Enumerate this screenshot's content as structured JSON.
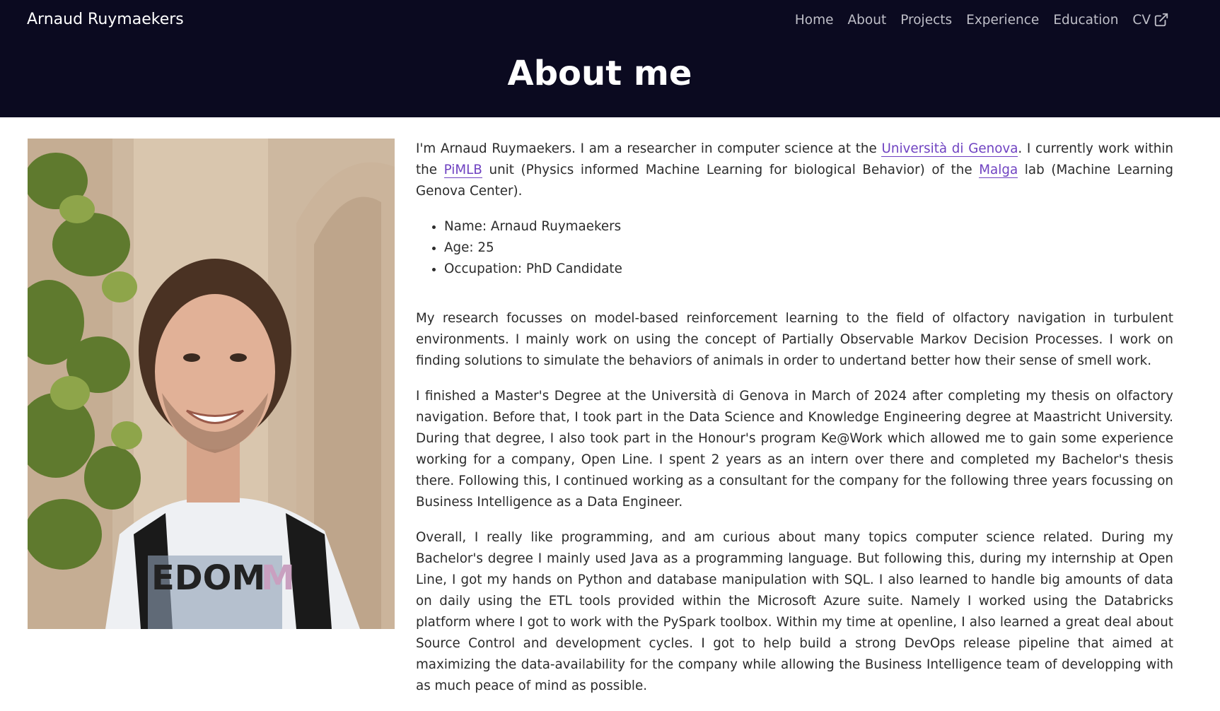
{
  "header": {
    "brand": "Arnaud Ruymaekers",
    "nav": [
      "Home",
      "About",
      "Projects",
      "Experience",
      "Education",
      "CV"
    ],
    "cv_icon": "external-link-icon",
    "title": "About me"
  },
  "portrait": {
    "shirt_text": "EDOM",
    "shirt_text_tail": "M"
  },
  "intro": {
    "t1": "I'm Arnaud Ruymaekers. I am a researcher in computer science at the ",
    "link_unige": "Università di Genova",
    "t2": ". I currently work within the ",
    "link_pimlb": "PiMLB",
    "t3": " unit (Physics informed Machine Learning for biological Behavior) of the ",
    "link_malga": "Malga",
    "t4": " lab (Machine Learning Genova Center)."
  },
  "facts": [
    "Name: Arnaud Ruymaekers",
    "Age: 25",
    "Occupation: PhD Candidate"
  ],
  "paragraphs": [
    "My research focusses on model-based reinforcement learning to the field of olfactory navigation in turbulent environments. I mainly work on using the concept of Partially Observable Markov Decision Processes. I work on finding solutions to simulate the behaviors of animals in order to undertand better how their sense of smell work.",
    "I finished a Master's Degree at the Università di Genova in March of 2024 after completing my thesis on olfactory navigation. Before that, I took part in the Data Science and Knowledge Engineering degree at Maastricht University. During that degree, I also took part in the Honour's program Ke@Work which allowed me to gain some experience working for a company, Open Line. I spent 2 years as an intern over there and completed my Bachelor's thesis there. Following this, I continued working as a consultant for the company for the following three years focussing on Business Intelligence as a Data Engineer.",
    "Overall, I really like programming, and am curious about many topics computer science related. During my Bachelor's degree I mainly used Java as a programming language. But following this, during my internship at Open Line, I got my hands on Python and database manipulation with SQL. I also learned to handle big amounts of data on daily using the ETL tools provided within the Microsoft Azure suite. Namely I worked using the Databricks platform where I got to work with the PySpark toolbox. Within my time at openline, I also learned a great deal about Source Control and development cycles. I got to help build a strong DevOps release pipeline that aimed at maximizing the data-availability for the company while allowing the Business Intelligence team of developping with as much peace of mind as possible."
  ],
  "colors": {
    "header_bg": "#0b0a20",
    "link": "#6f42c1",
    "nav_text": "#bfbfc8"
  }
}
